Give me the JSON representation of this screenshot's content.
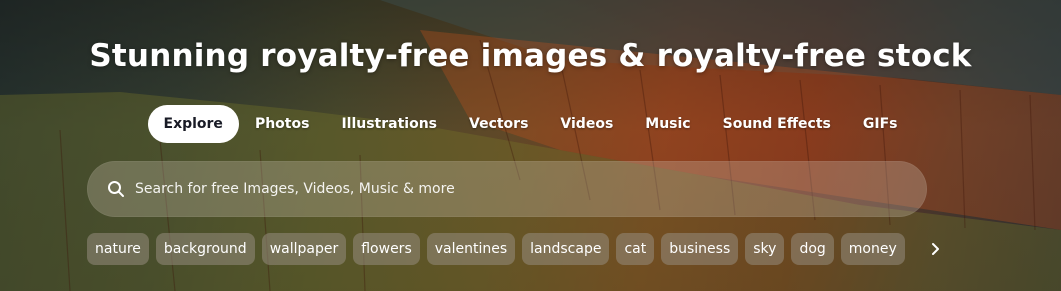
{
  "hero": {
    "title": "Stunning royalty-free images & royalty-free stock"
  },
  "tabs": [
    {
      "label": "Explore",
      "active": true
    },
    {
      "label": "Photos"
    },
    {
      "label": "Illustrations"
    },
    {
      "label": "Vectors"
    },
    {
      "label": "Videos"
    },
    {
      "label": "Music"
    },
    {
      "label": "Sound Effects"
    },
    {
      "label": "GIFs"
    }
  ],
  "search": {
    "placeholder": "Search for free Images, Videos, Music & more",
    "icon": "search-icon"
  },
  "chips": [
    "nature",
    "background",
    "wallpaper",
    "flowers",
    "valentines",
    "landscape",
    "cat",
    "business",
    "sky",
    "dog",
    "money"
  ],
  "chips_next_icon": "chevron-right-icon"
}
